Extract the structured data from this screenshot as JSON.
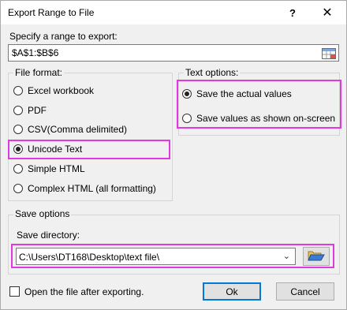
{
  "window": {
    "title": "Export Range to File",
    "help_glyph": "?",
    "close_glyph": "✕"
  },
  "range": {
    "label": "Specify a range to export:",
    "value": "$A$1:$B$6"
  },
  "file_format": {
    "legend": "File format:",
    "options": [
      {
        "label": "Excel workbook",
        "checked": false
      },
      {
        "label": "PDF",
        "checked": false
      },
      {
        "label": "CSV(Comma delimited)",
        "checked": false
      },
      {
        "label": "Unicode Text",
        "checked": true
      },
      {
        "label": "Simple HTML",
        "checked": false
      },
      {
        "label": "Complex HTML (all formatting)",
        "checked": false
      }
    ]
  },
  "text_options": {
    "legend": "Text options:",
    "options": [
      {
        "label": "Save the actual values",
        "checked": true
      },
      {
        "label": "Save values as shown on-screen",
        "checked": false
      }
    ]
  },
  "save_options": {
    "legend": "Save options",
    "directory_label": "Save directory:",
    "directory_value": "C:\\Users\\DT168\\Desktop\\text file\\"
  },
  "footer": {
    "open_after_label": "Open the file after exporting.",
    "open_after_checked": false,
    "ok_label": "Ok",
    "cancel_label": "Cancel"
  },
  "colors": {
    "highlight": "#e238e2",
    "default_button_border": "#0078d7"
  }
}
